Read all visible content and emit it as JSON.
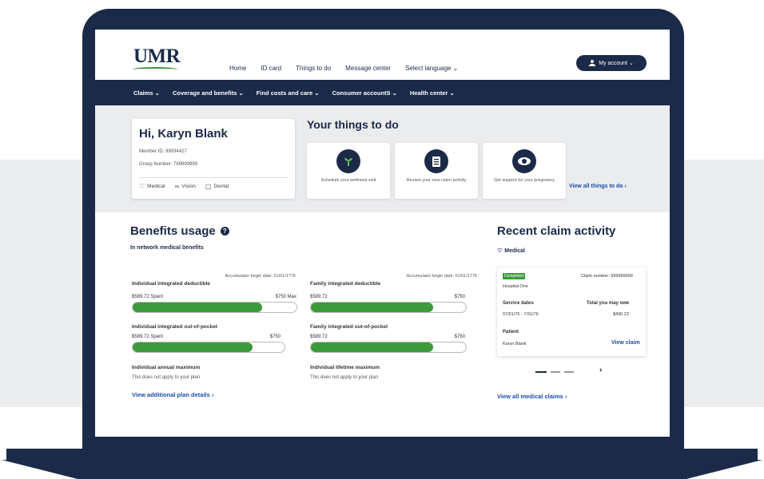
{
  "header": {
    "logo": "UMR",
    "nav": [
      "Home",
      "ID card",
      "Things to do",
      "Message center",
      "Select language ⌄"
    ],
    "account_label": "My account ⌄"
  },
  "main_nav": [
    "Claims ⌄",
    "Coverage and benefits ⌄",
    "Find costs and care ⌄",
    "Consumer accountS ⌄",
    "Health center ⌄"
  ],
  "member": {
    "greeting": "Hi, Karyn Blank",
    "member_id": "Member ID: 99934427",
    "group_number": "Group Number: 769999999",
    "coverage": [
      "Medical",
      "Vision",
      "Dental"
    ]
  },
  "things_to_do": {
    "title": "Your things to do",
    "tiles": [
      {
        "text": "Schedule your wellness visit",
        "icon": "plant-icon"
      },
      {
        "text": "Review your new claim activity",
        "icon": "clipboard-icon"
      },
      {
        "text": "Get support for your pregnancy",
        "icon": "eye-icon"
      }
    ],
    "view_all": "View all things to do"
  },
  "benefits": {
    "title": "Benefits usage",
    "subtitle": "In network medical benefits",
    "accumulator_left": "Accumulator begin date: 01/01/1776",
    "accumulator_right": "Accumulator begin date: 01/01/1776",
    "items": [
      {
        "label": "Individual integrated deductible",
        "spent": "$589.72 Spent",
        "limit": "$750 Max",
        "fraction": 0.79
      },
      {
        "label": "Family integrated deductible",
        "spent": "$589.72",
        "limit": "$750",
        "fraction": 0.79
      },
      {
        "label": "Individual integrated out-of-pocket",
        "spent": "$589.72 Spent",
        "limit": "$750",
        "fraction": 0.79
      },
      {
        "label": "Family integrated out-of-pocket",
        "spent": "$589.72",
        "limit": "$750",
        "fraction": 0.79
      }
    ],
    "annual_max_label": "Individual annual maximum",
    "annual_max_note": "This does not apply to your plan",
    "lifetime_max_label": "Individual lifetime maximum",
    "lifetime_max_note": "This does not apply to your plan",
    "plan_link": "View additional plan details"
  },
  "claims": {
    "title": "Recent claim activity",
    "category": "Medical",
    "card": {
      "status": "Completed",
      "claim_number": "Claim number: 999999999",
      "provider": "Hospital One",
      "service_dates_label": "Service dates",
      "service_dates": "07/01/76 - 7/31/76",
      "total_label": "Total you may owe",
      "total": "$490.23",
      "patient_label": "Patient",
      "patient": "Karyn Blank",
      "view_claim": "View claim"
    },
    "view_all": "View all medical claims"
  },
  "colors": {
    "navy": "#1b2a48",
    "green": "#3c9a3a",
    "link": "#1b4ea8",
    "band": "#ebecee"
  }
}
